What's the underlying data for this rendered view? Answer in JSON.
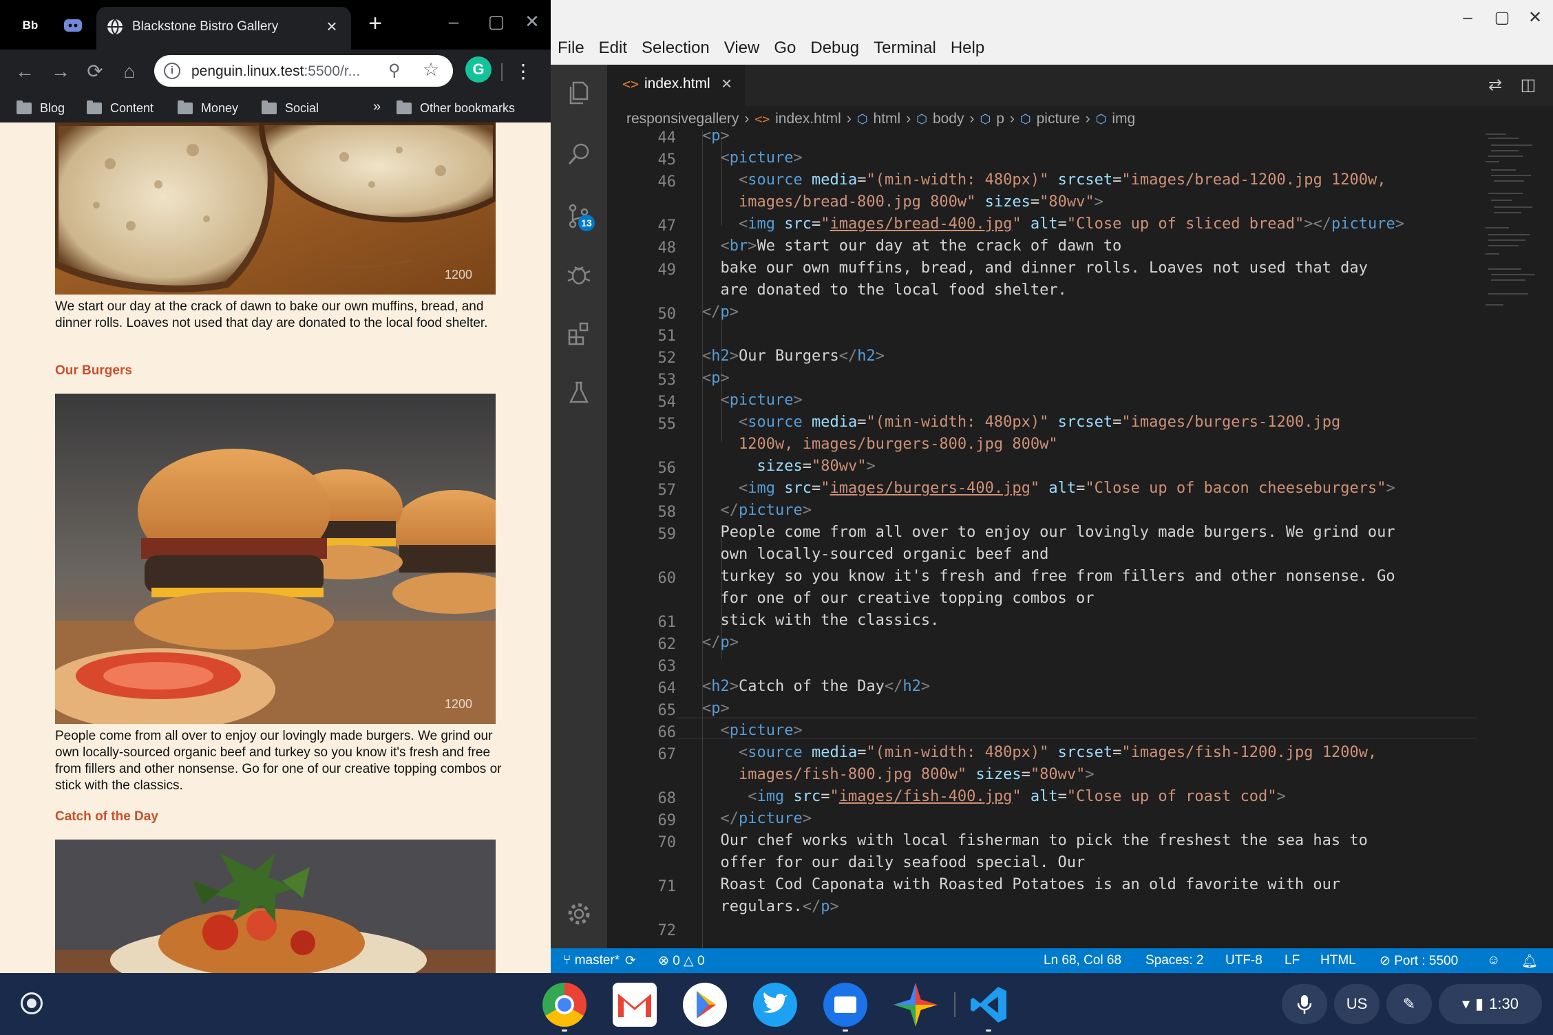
{
  "chrome": {
    "pinned_tab_label": "Bb",
    "tab_title": "Blackstone Bistro Gallery",
    "url_host": "penguin.linux.test",
    "url_rest": ":5500/r...",
    "bookmarks": [
      "Blog",
      "Content",
      "Money",
      "Social"
    ],
    "bookmarks_more": "»",
    "other_bookmarks": "Other bookmarks",
    "page": {
      "bread_res": "1200",
      "bread_para": "We start our day at the crack of dawn to bake our own muffins, bread, and dinner rolls. Loaves not used that day are donated to the local food shelter.",
      "burgers_heading": "Our Burgers",
      "burgers_res": "1200",
      "burgers_para": "People come from all over to enjoy our lovingly made burgers. We grind our own locally-sourced organic beef and turkey so you know it's fresh and free from fillers and other nonsense. Go for one of our creative topping combos or stick with the classics.",
      "fish_heading": "Catch of the Day"
    }
  },
  "vscode": {
    "menu": [
      "File",
      "Edit",
      "Selection",
      "View",
      "Go",
      "Debug",
      "Terminal",
      "Help"
    ],
    "scm_badge": "13",
    "tab_name": "index.html",
    "breadcrumbs": [
      "responsivegallery",
      "index.html",
      "html",
      "body",
      "p",
      "picture",
      "img"
    ],
    "line_numbers": [
      "44",
      "45",
      "46",
      "47",
      "48",
      "49",
      "50",
      "51",
      "52",
      "53",
      "54",
      "55",
      "56",
      "57",
      "58",
      "59",
      "60",
      "61",
      "62",
      "63",
      "64",
      "65",
      "66",
      "67",
      "68",
      "69",
      "70",
      "71",
      "72"
    ],
    "status": {
      "branch": "master*",
      "errors": "0",
      "warnings": "0",
      "position": "Ln 68, Col 68",
      "spaces": "Spaces: 2",
      "encoding": "UTF-8",
      "eol": "LF",
      "language": "HTML",
      "port": "Port : 5500"
    }
  },
  "shelf": {
    "ime": "US",
    "time": "1:30"
  },
  "colors": {
    "page_bg": "#fbf0df",
    "heading": "#c8502e",
    "statusbar": "#007acc",
    "shelf": "#1a2a4a"
  }
}
